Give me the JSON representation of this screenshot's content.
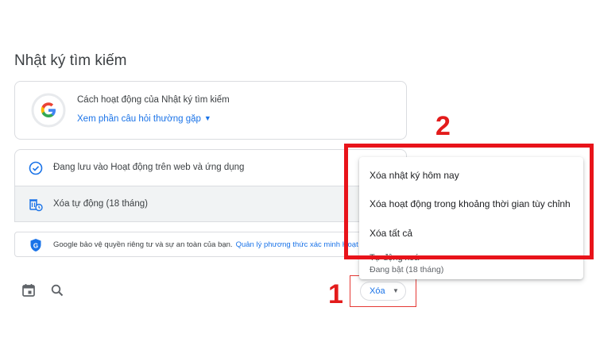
{
  "page": {
    "title": "Nhật ký tìm kiếm"
  },
  "info_card": {
    "title": "Cách hoạt động của Nhật ký tìm kiếm",
    "link": "Xem phần câu hỏi thường gặp"
  },
  "settings": {
    "web_activity": "Đang lưu vào Hoạt động trên web và ứng dụng",
    "auto_delete": "Xóa tự động (18 tháng)"
  },
  "privacy": {
    "text": "Google bảo vệ quyền riêng tư và sự an toàn của bạn.",
    "link": "Quản lý phương thức xác minh Hoạt động"
  },
  "delete_button": {
    "label": "Xóa"
  },
  "menu": {
    "items": [
      "Xóa nhật ký hôm nay",
      "Xóa hoạt động trong khoảng thời gian tùy chỉnh",
      "Xóa tất cả",
      "Tự động xoá"
    ],
    "auto_delete_status": "Đang bật (18 tháng)"
  },
  "annotations": {
    "step1": "1",
    "step2": "2"
  },
  "colors": {
    "accent": "#1a73e8",
    "annotation": "#e31b1b",
    "google_blue": "#4285f4",
    "google_red": "#ea4335",
    "google_yellow": "#fbbc05",
    "google_green": "#34a853"
  },
  "icons": [
    "google-logo-icon",
    "check-circle-icon",
    "auto-delete-icon",
    "shield-icon",
    "calendar-icon",
    "search-icon",
    "caret-down-icon"
  ]
}
